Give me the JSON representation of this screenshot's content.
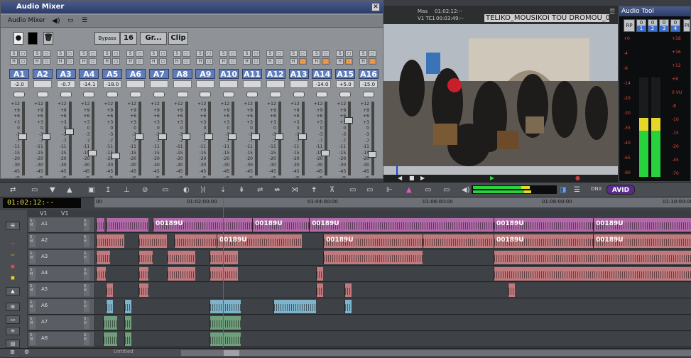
{
  "mixer": {
    "title": "Audio Mixer",
    "menu_label": "Audio Mixer",
    "bypass": "Bypass",
    "count": "16",
    "group": "Gr...",
    "clip": "Clip",
    "channels": [
      {
        "label": "A1",
        "gain": "-2.0",
        "fader": 0.45,
        "hot": false
      },
      {
        "label": "A2",
        "gain": "",
        "fader": 0.45,
        "hot": false
      },
      {
        "label": "A3",
        "gain": "-0.7",
        "fader": 0.38,
        "hot": false
      },
      {
        "label": "A4",
        "gain": "-14.1",
        "fader": 0.68,
        "hot": false
      },
      {
        "label": "A5",
        "gain": "-18.0",
        "fader": 0.72,
        "hot": false
      },
      {
        "label": "A6",
        "gain": "",
        "fader": 0.45,
        "hot": false
      },
      {
        "label": "A7",
        "gain": "",
        "fader": 0.45,
        "hot": false
      },
      {
        "label": "A8",
        "gain": "",
        "fader": 0.45,
        "hot": false
      },
      {
        "label": "A9",
        "gain": "",
        "fader": 0.45,
        "hot": false
      },
      {
        "label": "A10",
        "gain": "",
        "fader": 0.45,
        "hot": false
      },
      {
        "label": "A11",
        "gain": "",
        "fader": 0.45,
        "hot": false
      },
      {
        "label": "A12",
        "gain": "",
        "fader": 0.45,
        "hot": false
      },
      {
        "label": "A13",
        "gain": "",
        "fader": 0.45,
        "hot": true
      },
      {
        "label": "A14",
        "gain": "-14.0",
        "fader": 0.68,
        "hot": true
      },
      {
        "label": "A15",
        "gain": "+5.0",
        "fader": 0.22,
        "hot": true
      },
      {
        "label": "A16",
        "gain": "-15.0",
        "fader": 0.7,
        "hot": true
      }
    ],
    "scale": [
      "+12",
      "+9",
      "+6",
      "+3",
      "0",
      "-3",
      "-7",
      "-11",
      "-15",
      "-20",
      "-30",
      "-45",
      "-∞"
    ]
  },
  "monitor": {
    "mas_label": "Mas",
    "mas_time": "01:02:12:--",
    "tc_label": "V1 TC1",
    "tc_time": "00:03:49:--",
    "clip_title": "TELIKO_MOUSIKOI TOU DROMOU_00"
  },
  "audio_tool": {
    "title": "Audio Tool",
    "rp": "RP",
    "pi": "PI",
    "channels": [
      "1",
      "2",
      "3",
      "4"
    ],
    "left_scale": [
      "+0",
      "-4",
      "-8",
      "-14",
      "-20",
      "-30",
      "-35",
      "-40",
      "-65",
      "-90"
    ],
    "right_scale": [
      "+18",
      "+16",
      "+12",
      "+8",
      "0 VU",
      "-8",
      "-10",
      "-15",
      "-20",
      "-45",
      "-70"
    ],
    "levels": [
      0.55,
      0.55
    ]
  },
  "timeline": {
    "timecode": "01:02:12:--",
    "v1_label": "V1",
    "v1_label2": "V1",
    "ruler": [
      "00",
      "01:02:00:00",
      "01:04:00:00",
      "01:06:00:00",
      "01:08:00:00",
      "01:10:00:00"
    ],
    "brand": "AVID",
    "tracks": [
      {
        "name": "A1",
        "clip_label": "00189U",
        "color": "#b16aa8"
      },
      {
        "name": "A2",
        "clip_label": "00189U",
        "color": "#c07a7e"
      },
      {
        "name": "A3",
        "clip_label": "",
        "color": "#c07a7e"
      },
      {
        "name": "A4",
        "clip_label": "",
        "color": "#c07a7e"
      },
      {
        "name": "A5",
        "clip_label": "",
        "color": "#c07a7e"
      },
      {
        "name": "A6",
        "clip_label": "",
        "color": "#7fb3c9"
      },
      {
        "name": "A7",
        "clip_label": "",
        "color": "#6f9f7c"
      },
      {
        "name": "A8",
        "clip_label": "",
        "color": "#6f9f7c"
      }
    ],
    "sequence_name": "Untitled"
  }
}
